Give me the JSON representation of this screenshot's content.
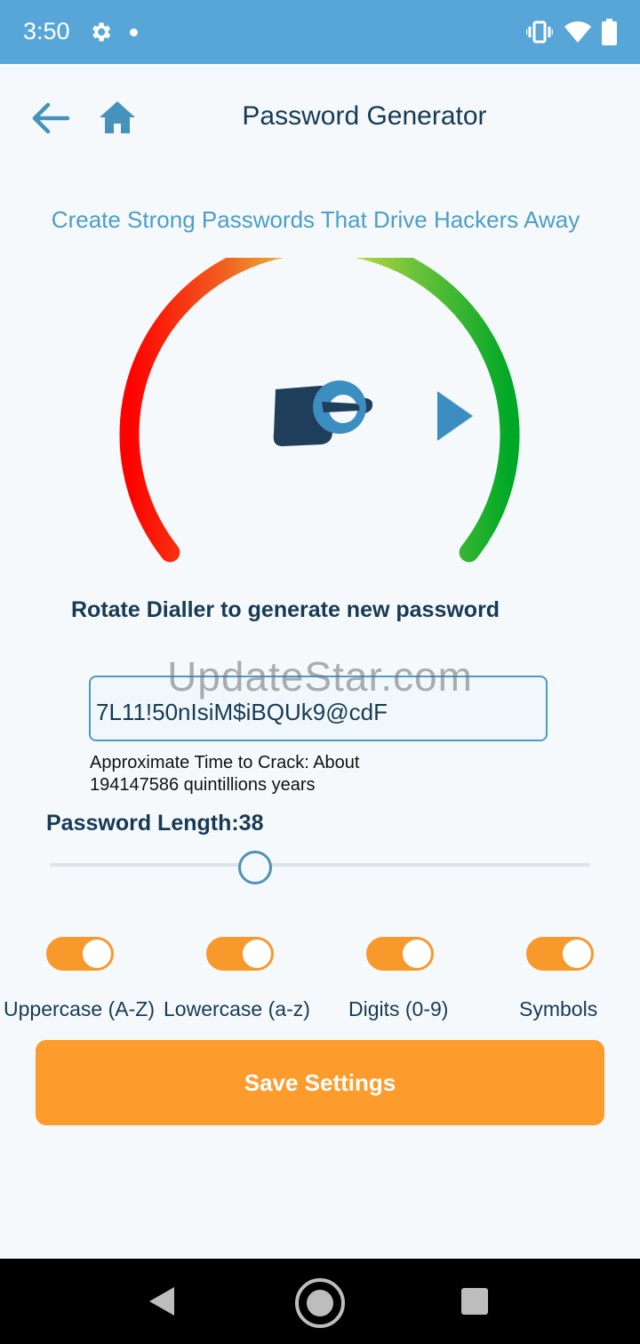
{
  "status_bar": {
    "time": "3:50",
    "icons": [
      "gear-icon",
      "notification-dot-icon",
      "vibrate-icon",
      "wifi-icon",
      "battery-icon"
    ]
  },
  "header": {
    "title": "Password Generator",
    "back_icon": "arrow-left-icon",
    "home_icon": "home-icon"
  },
  "tagline": "Create Strong Passwords That Drive Hackers Away",
  "dial": {
    "icons": [
      "pointing-hand-icon",
      "play-arrow-icon"
    ],
    "gradient_colors": [
      "#ff0000",
      "#e8e33a",
      "#00a827"
    ]
  },
  "instruction": "Rotate Dialler to generate new password",
  "watermark": "UpdateStar.com",
  "password": {
    "value": "7L11!50nIsiM$iBQUk9@cdF"
  },
  "crack_time": {
    "label": "Approximate Time to Crack: About",
    "value": "194147586 quintillions years"
  },
  "length": {
    "label": "Password Length:38",
    "slider_fraction": 0.38
  },
  "options": [
    {
      "label": "Uppercase (A-Z)",
      "enabled": true
    },
    {
      "label": "Lowercase (a-z)",
      "enabled": true
    },
    {
      "label": "Digits (0-9)",
      "enabled": true
    },
    {
      "label": "Symbols",
      "enabled": true
    }
  ],
  "save_button": {
    "label": "Save Settings"
  },
  "colors": {
    "status_bar": "#58a6d8",
    "accent": "#f7992b",
    "title": "#173a54",
    "tagline": "#4c9ec6"
  },
  "nav_bar": {
    "icons": [
      "back-triangle-icon",
      "home-circle-icon",
      "recent-apps-icon"
    ]
  }
}
